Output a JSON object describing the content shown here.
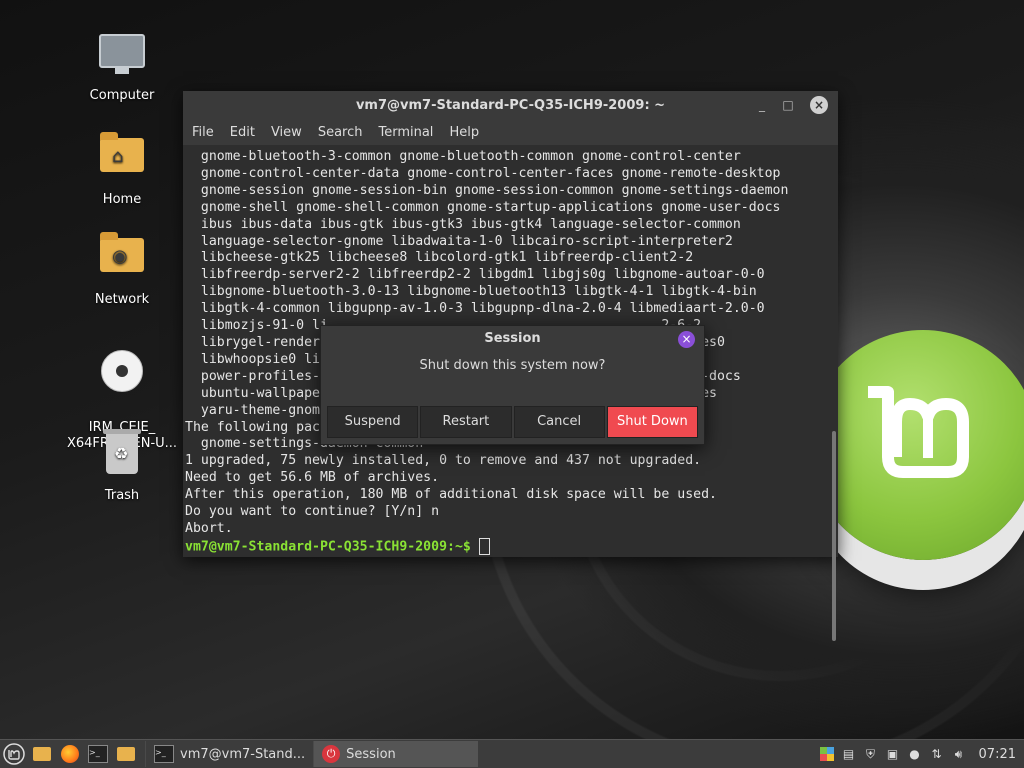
{
  "desktop": {
    "icons": [
      {
        "label": "Computer",
        "icon": "computer-icon"
      },
      {
        "label": "Home",
        "icon": "home-folder-icon"
      },
      {
        "label": "Network",
        "icon": "network-folder-icon"
      },
      {
        "label": "IRM_CEIE_\nX64FREV_EN-U...",
        "icon": "optical-disc-icon"
      },
      {
        "label": "Trash",
        "icon": "trash-icon"
      }
    ]
  },
  "terminal": {
    "title": "vm7@vm7-Standard-PC-Q35-ICH9-2009: ~",
    "menu": [
      "File",
      "Edit",
      "View",
      "Search",
      "Terminal",
      "Help"
    ],
    "lines": [
      "  gnome-bluetooth-3-common gnome-bluetooth-common gnome-control-center",
      "  gnome-control-center-data gnome-control-center-faces gnome-remote-desktop",
      "  gnome-session gnome-session-bin gnome-session-common gnome-settings-daemon",
      "  gnome-shell gnome-shell-common gnome-startup-applications gnome-user-docs",
      "  ibus ibus-data ibus-gtk ibus-gtk3 ibus-gtk4 language-selector-common",
      "  language-selector-gnome libadwaita-1-0 libcairo-script-interpreter2",
      "  libcheese-gtk25 libcheese8 libcolord-gtk1 libfreerdp-client2-2",
      "  libfreerdp-server2-2 libfreerdp2-2 libgdm1 libgjs0g libgnome-autoar-0-0",
      "  libgnome-bluetooth-3.0-13 libgnome-bluetooth13 libgtk-4-1 libgtk-4-bin",
      "  libgtk-4-common libgupnp-av-1.0-3 libgupnp-dlna-2.0-4 libmediaart-2.0-0",
      "  libmozjs-91-0 li                                          2-6-2",
      "  librygel-render                                            rences0",
      "  libwhoopsie0 li",
      "  power-profiles-                                          ubuntu-docs",
      "  ubuntu-wallpape                                          ferences",
      "  yaru-theme-gnom",
      "The following pac",
      "  gnome-settings-daemon-common",
      "1 upgraded, 75 newly installed, 0 to remove and 437 not upgraded.",
      "Need to get 56.6 MB of archives.",
      "After this operation, 180 MB of additional disk space will be used.",
      "Do you want to continue? [Y/n] n",
      "Abort."
    ],
    "prompt": "vm7@vm7-Standard-PC-Q35-ICH9-2009:~$",
    "prompt_suffix": " "
  },
  "dialog": {
    "title": "Session",
    "message": "Shut down this system now?",
    "buttons": {
      "suspend": "Suspend",
      "restart": "Restart",
      "cancel": "Cancel",
      "shutdown": "Shut Down"
    },
    "danger_color": "#f04a50"
  },
  "taskbar": {
    "tasks": [
      {
        "label": "vm7@vm7-Stand...",
        "icon": "terminal-icon"
      },
      {
        "label": "Session",
        "icon": "power-icon"
      }
    ],
    "clock": "07:21"
  }
}
